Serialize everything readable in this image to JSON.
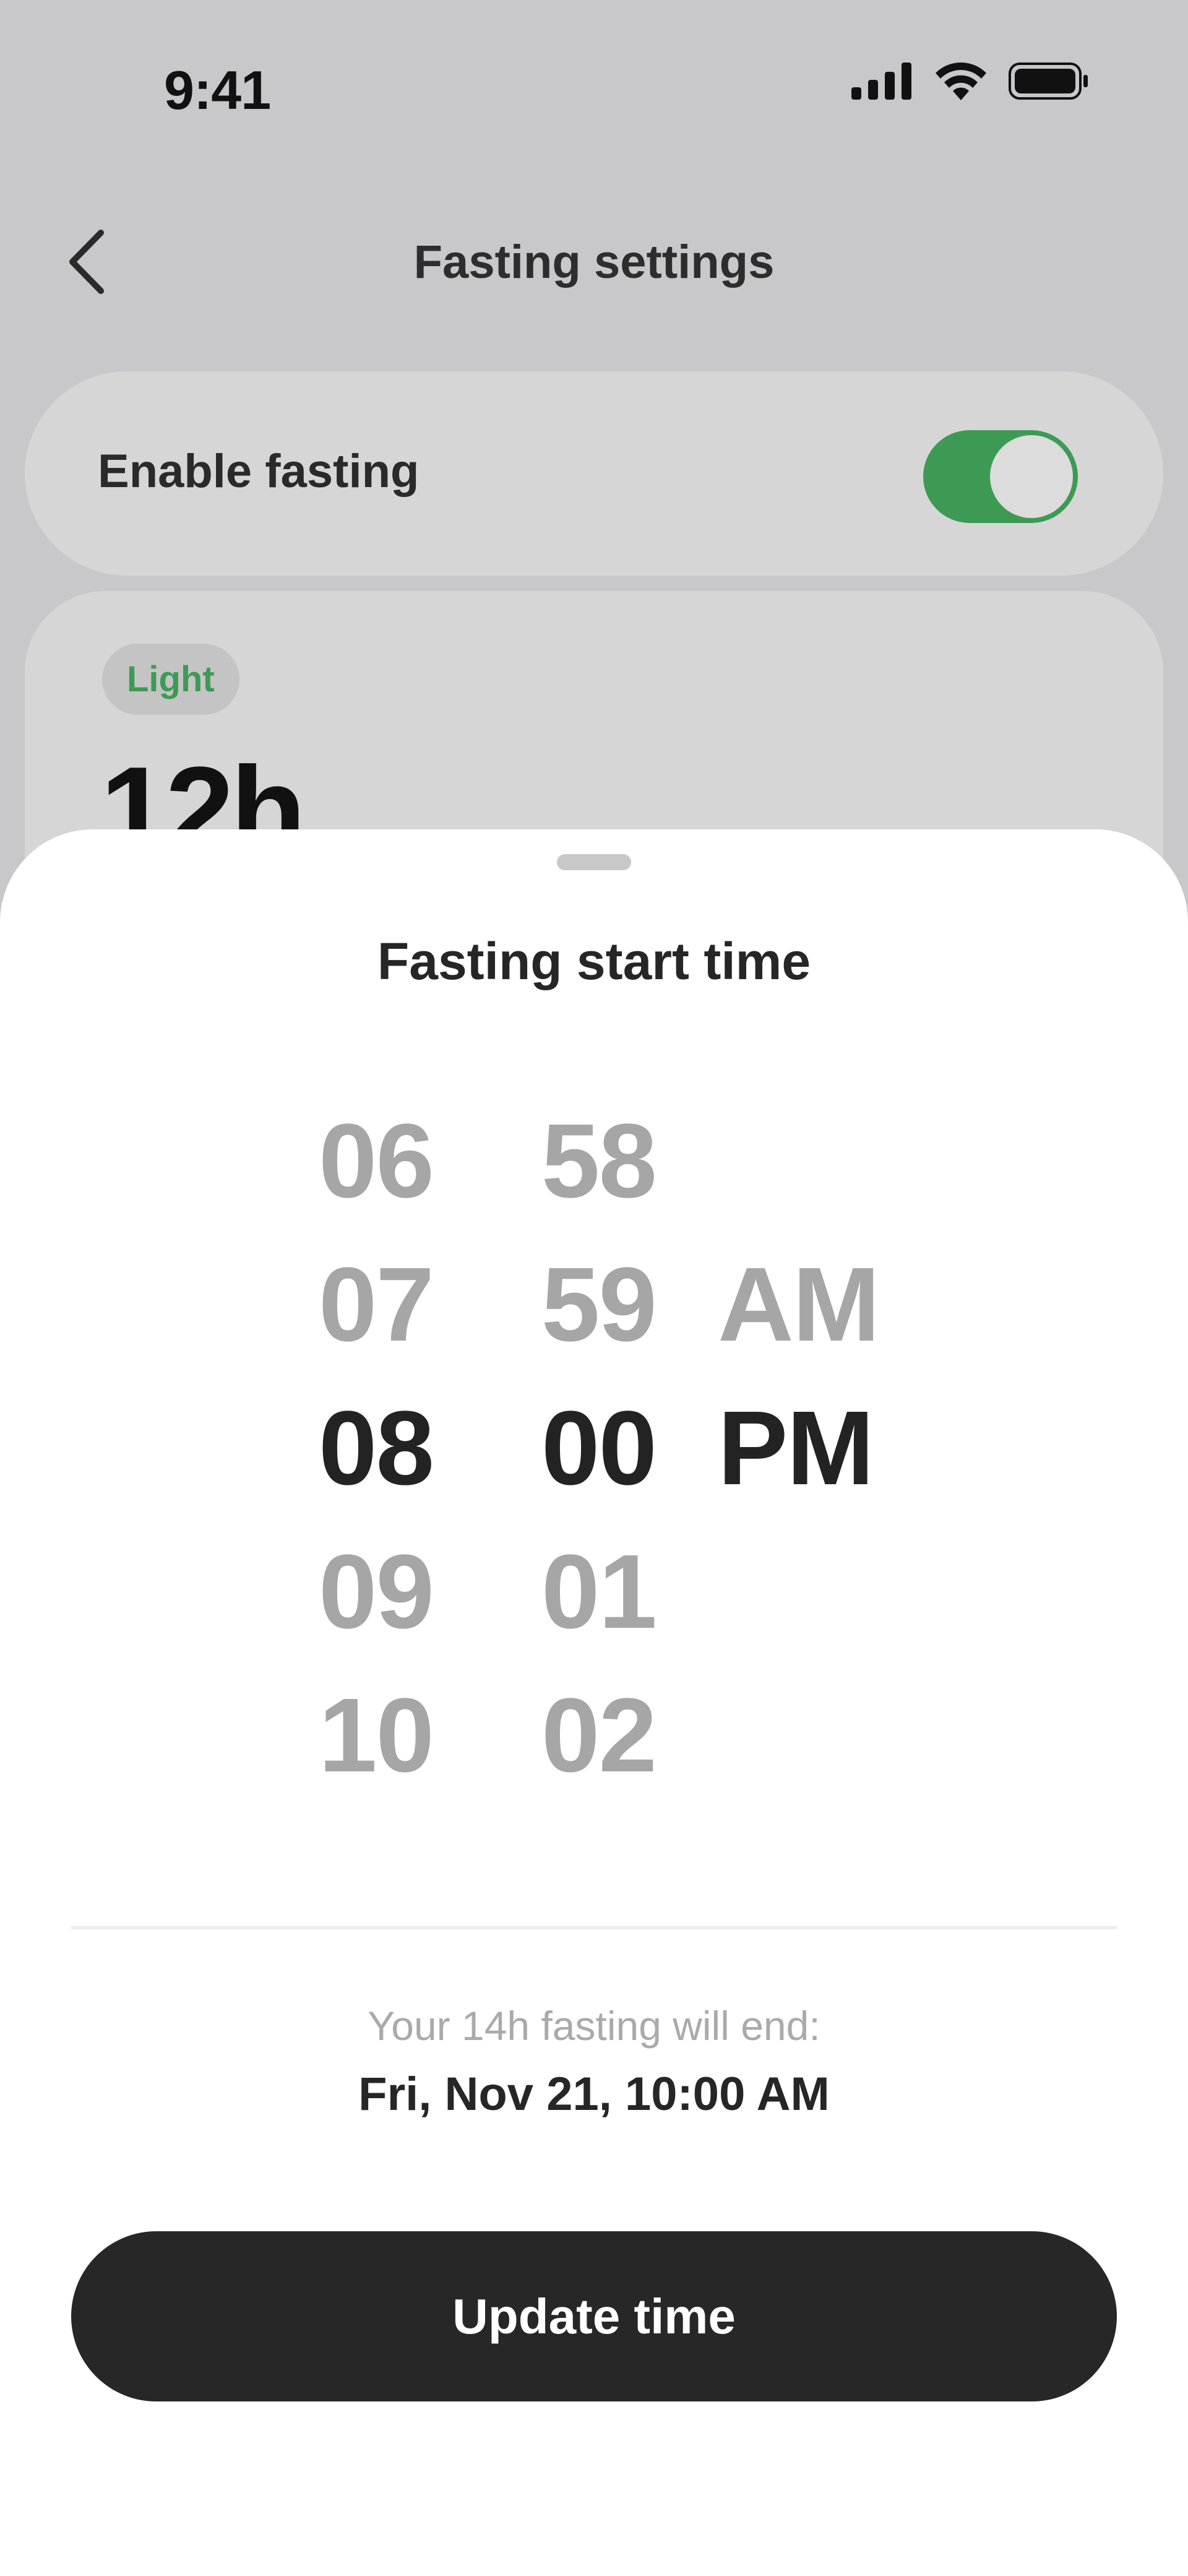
{
  "status_bar": {
    "time": "9:41",
    "icons": [
      "cellular-signal-icon",
      "wifi-icon",
      "battery-icon"
    ]
  },
  "nav": {
    "title": "Fasting settings",
    "back_icon": "chevron-left-icon"
  },
  "settings": {
    "enable_fasting_label": "Enable fasting",
    "enable_fasting_on": true,
    "plan_badge": "Light",
    "plan_duration": "12h"
  },
  "sheet": {
    "title": "Fasting start time",
    "picker": {
      "hours": [
        "06",
        "07",
        "08",
        "09",
        "10"
      ],
      "minutes": [
        "58",
        "59",
        "00",
        "01",
        "02"
      ],
      "periods": [
        "",
        "AM",
        "PM",
        "",
        ""
      ],
      "selected_hour": "08",
      "selected_minute": "00",
      "selected_period": "PM"
    },
    "end_caption": "Your 14h fasting will end:",
    "end_value": "Fri, Nov 21, 10:00 AM",
    "update_button_label": "Update time"
  },
  "colors": {
    "accent_green": "#3d9a55",
    "button_dark": "#272727",
    "overlay_gray": "#c8c8cb"
  }
}
